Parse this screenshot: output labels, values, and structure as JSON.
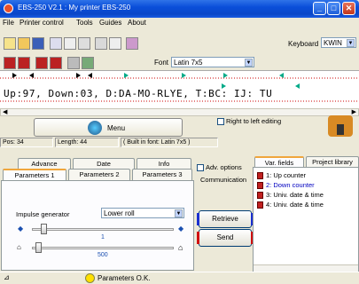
{
  "window": {
    "title": "EBS-250 V2.1  :  My printer EBS-250",
    "min": "_",
    "max": "□",
    "close": "✕"
  },
  "menubar": {
    "items": [
      "File",
      "Printer control",
      "Tools",
      "Guides",
      "About"
    ]
  },
  "toolbar": {
    "keyboard_label": "Keyboard",
    "keyboard_value": "KWIN",
    "font_label": "Font",
    "font_value": "Latin 7x5"
  },
  "editor": {
    "text": "Up:97, Down:03, D:DA-MO-RLYE, T:BC: IJ: TU",
    "menu_button": "Menu",
    "rtl_checkbox": "Right to left editing"
  },
  "info": {
    "pos": "Pos: 34",
    "length": "Length: 44",
    "font_info": "( Built in font: Latin 7x5 )"
  },
  "tabs": {
    "row1": [
      "Advance",
      "Date",
      "Info"
    ],
    "row2": [
      "Parameters 1",
      "Parameters 2",
      "Parameters 3"
    ],
    "adv_options": "Adv. options",
    "communication": "Communication"
  },
  "params": {
    "impulse_label": "Impulse generator",
    "impulse_value": "Lower roll",
    "slider1_value": "1",
    "slider2_value": "500"
  },
  "comm": {
    "retrieve": "Retrieve",
    "send": "Send"
  },
  "right_panel": {
    "tabs": [
      "Var. fields",
      "Project library"
    ],
    "items": [
      "1: Up counter",
      "2: Down counter",
      "3: Univ. date & time",
      "4: Univ. date & time"
    ]
  },
  "statusbar": {
    "message": "Parameters O.K."
  },
  "colors": {
    "title_blue": "#0a4ed9",
    "highlight": "#0000c0",
    "accent_red": "#d01010"
  }
}
